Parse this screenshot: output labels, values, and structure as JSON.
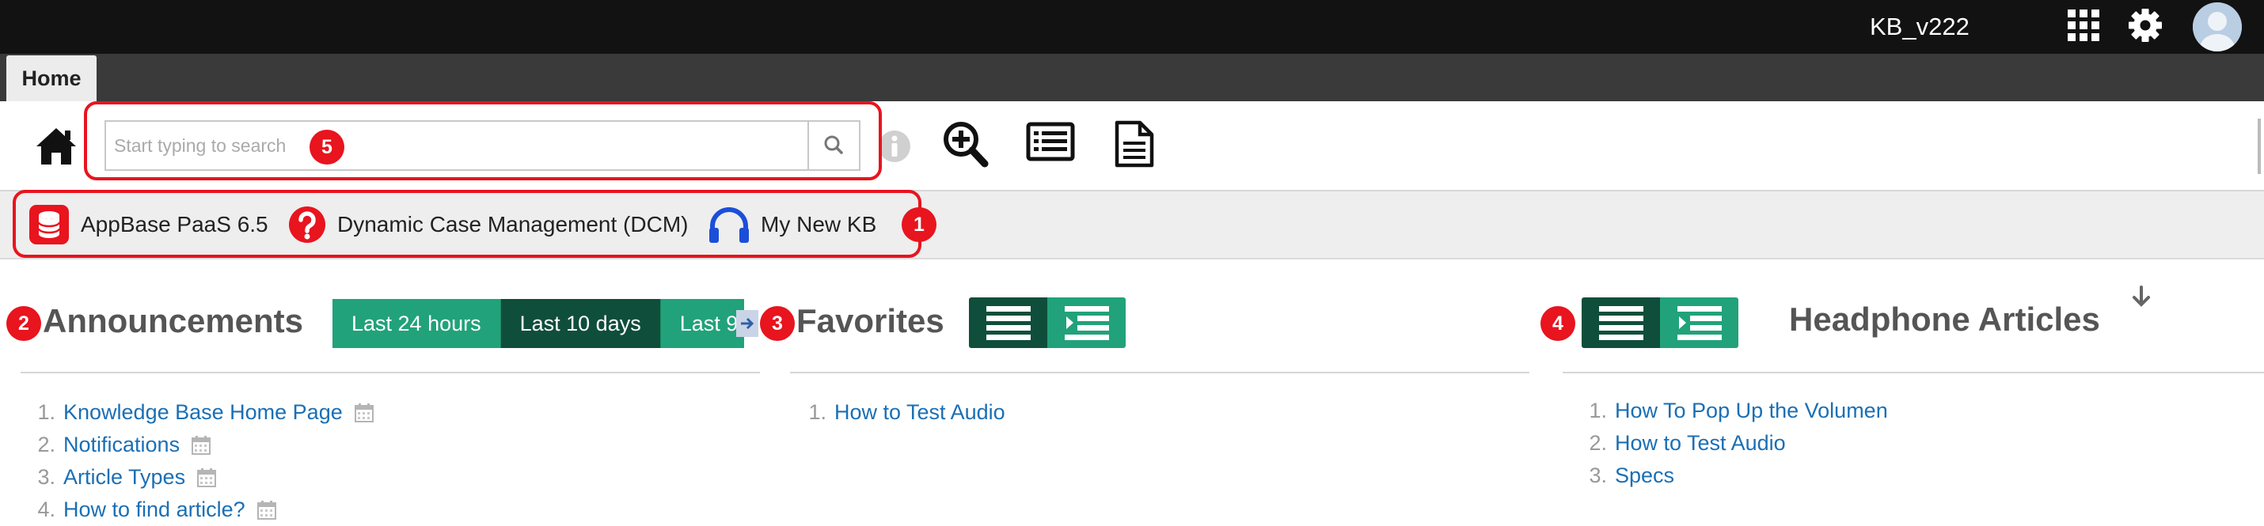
{
  "app": {
    "title": "KB_v222"
  },
  "tabs": [
    {
      "label": "Home"
    }
  ],
  "search": {
    "placeholder": "Start typing to search",
    "value": ""
  },
  "knowledge_bases": [
    {
      "label": "AppBase PaaS 6.5",
      "icon": "database-icon"
    },
    {
      "label": "Dynamic Case Management (DCM)",
      "icon": "question-icon"
    },
    {
      "label": "My New KB",
      "icon": "headphones-icon"
    }
  ],
  "annotations": {
    "kb_bar": "1",
    "announcements": "2",
    "favorites": "3",
    "headphone": "4",
    "search": "5"
  },
  "announcements": {
    "title": "Announcements",
    "filters": [
      {
        "label": "Last 24 hours",
        "active": false
      },
      {
        "label": "Last 10 days",
        "active": true
      },
      {
        "label": "Last 9",
        "active": false
      }
    ],
    "items": [
      {
        "num": "1.",
        "label": "Knowledge Base Home Page"
      },
      {
        "num": "2.",
        "label": "Notifications"
      },
      {
        "num": "3.",
        "label": "Article Types"
      },
      {
        "num": "4.",
        "label": "How to find article?"
      }
    ]
  },
  "favorites": {
    "title": "Favorites",
    "items": [
      {
        "num": "1.",
        "label": "How to Test Audio"
      }
    ]
  },
  "headphone": {
    "title": "Headphone Articles",
    "items": [
      {
        "num": "1.",
        "label": "How To Pop Up the Volumen"
      },
      {
        "num": "2.",
        "label": "How to Test Audio"
      },
      {
        "num": "3.",
        "label": "Specs"
      }
    ]
  },
  "colors": {
    "accent": "#21a27a",
    "accent_dark": "#0f4e3a",
    "link": "#1a6fb5",
    "annotation": "#e8141e",
    "topbar": "#121212"
  }
}
